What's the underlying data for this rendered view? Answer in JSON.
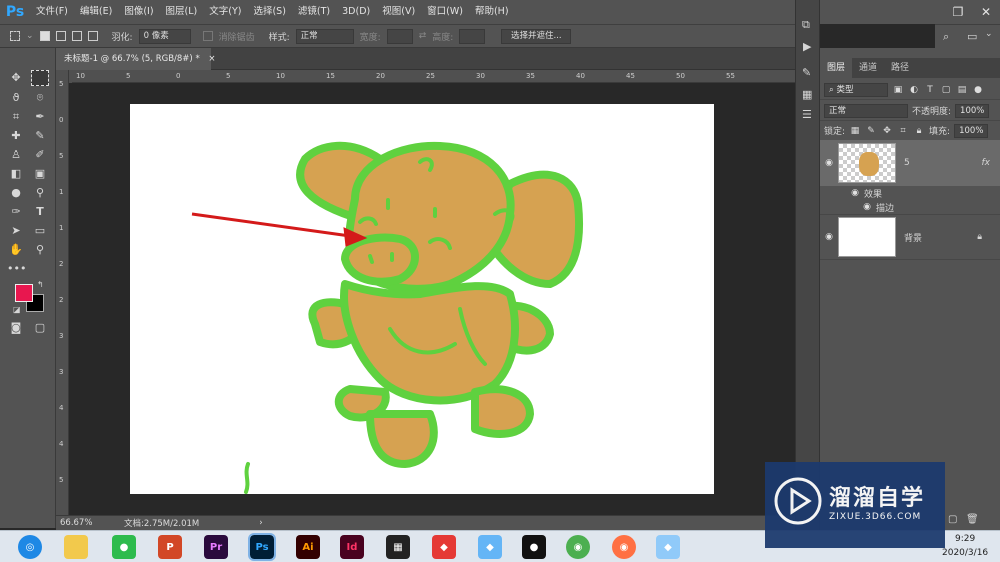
{
  "app": {
    "logo": "Ps"
  },
  "menubar": {
    "items": [
      "文件(F)",
      "编辑(E)",
      "图像(I)",
      "图层(L)",
      "文字(Y)",
      "选择(S)",
      "滤镜(T)",
      "3D(D)",
      "视图(V)",
      "窗口(W)",
      "帮助(H)"
    ]
  },
  "options": {
    "feather_label": "羽化:",
    "feather_value": "0 像素",
    "antialias_label": "消除锯齿",
    "style_label": "样式:",
    "style_value": "正常",
    "width_label": "宽度:",
    "height_label": "高度:",
    "select_mask_button": "选择并遮住..."
  },
  "document": {
    "tab_title": "未标题-1 @ 66.7% (5, RGB/8#) *"
  },
  "ruler": {
    "h_labels": [
      "10",
      "5",
      "0",
      "5",
      "10",
      "15",
      "20",
      "25",
      "30",
      "35",
      "40",
      "45",
      "50",
      "55"
    ],
    "v_labels": [
      "5",
      "0",
      "5",
      "1",
      "1",
      "2",
      "2",
      "3",
      "3",
      "4",
      "4",
      "5"
    ]
  },
  "status": {
    "zoom": "66.67%",
    "doc_info": "文档:2.75M/2.01M"
  },
  "panel": {
    "tabs": [
      "图层",
      "通道",
      "路径"
    ],
    "filter_kind": "类型",
    "blend_mode": "正常",
    "opacity_label": "不透明度:",
    "opacity_value": "100%",
    "lock_label": "锁定:",
    "fill_label": "填充:",
    "fill_value": "100%",
    "layers": [
      {
        "name": "5",
        "fx": "fx",
        "effects_label": "效果",
        "effect_name": "描边"
      },
      {
        "name": "背景"
      }
    ]
  },
  "colors": {
    "foreground": "#e8174f",
    "background": "#000000",
    "stroke": "#5fd13f",
    "pig_fill": "#d6a251",
    "arrow": "#d41a1a"
  },
  "taskbar": {
    "apps": [
      "Pr",
      "Ps",
      "Ai",
      "Id"
    ],
    "time": "9:29",
    "date": "2020/3/16"
  },
  "watermark": {
    "brand": "溜溜自学",
    "url": "ZIXUE.3D66.COM"
  }
}
